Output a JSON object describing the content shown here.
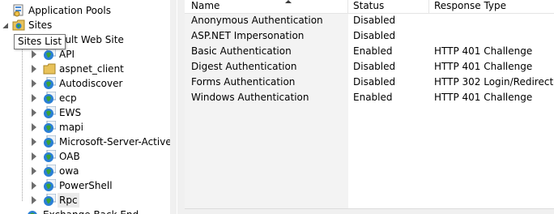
{
  "tree": {
    "tooltip": "Sites List",
    "top_items": [
      {
        "label": "Application Pools"
      },
      {
        "label": "Sites"
      }
    ],
    "default_site_label_partial": "ault Web Site",
    "children": [
      {
        "label": "API",
        "icon": "globe-icon"
      },
      {
        "label": "aspnet_client",
        "icon": "folder-icon"
      },
      {
        "label": "Autodiscover",
        "icon": "globe-icon"
      },
      {
        "label": "ecp",
        "icon": "globe-icon"
      },
      {
        "label": "EWS",
        "icon": "globe-icon"
      },
      {
        "label": "mapi",
        "icon": "globe-icon"
      },
      {
        "label": "Microsoft-Server-ActiveSy",
        "icon": "globe-icon"
      },
      {
        "label": "OAB",
        "icon": "globe-icon"
      },
      {
        "label": "owa",
        "icon": "globe-icon"
      },
      {
        "label": "PowerShell",
        "icon": "globe-icon"
      },
      {
        "label": "Rpc",
        "icon": "globe-icon"
      }
    ],
    "partial_bottom_label": "Exchange Back End"
  },
  "list": {
    "columns": [
      "Name",
      "Status",
      "Response Type"
    ],
    "rows": [
      {
        "name": "Anonymous Authentication",
        "status": "Disabled",
        "response": ""
      },
      {
        "name": "ASP.NET Impersonation",
        "status": "Disabled",
        "response": ""
      },
      {
        "name": "Basic Authentication",
        "status": "Enabled",
        "response": "HTTP 401 Challenge"
      },
      {
        "name": "Digest Authentication",
        "status": "Disabled",
        "response": "HTTP 401 Challenge"
      },
      {
        "name": "Forms Authentication",
        "status": "Disabled",
        "response": "HTTP 302 Login/Redirect"
      },
      {
        "name": "Windows Authentication",
        "status": "Enabled",
        "response": "HTTP 401 Challenge"
      }
    ]
  },
  "colors": {
    "tree_line": "#a0a0a0",
    "globe_blue": "#2a7fd4",
    "globe_green": "#3aa335",
    "folder_yellow": "#e8c25b",
    "selected_row": "#d9ebf9"
  }
}
